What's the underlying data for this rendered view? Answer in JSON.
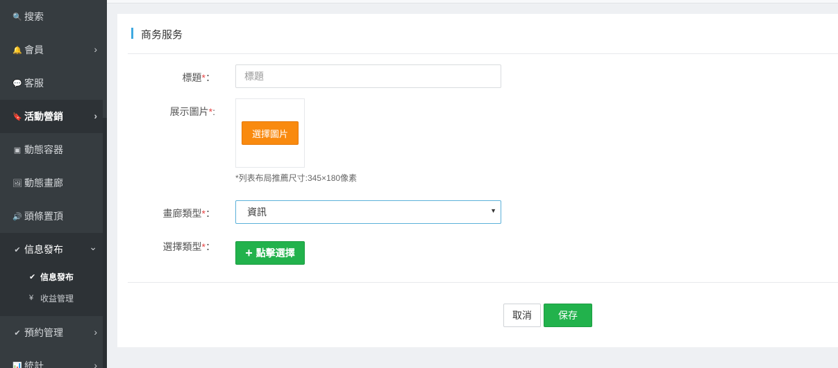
{
  "sidebar": {
    "items": [
      {
        "label": "搜索",
        "icon": "search-icon",
        "glyph": "🔍"
      },
      {
        "label": "會員",
        "icon": "bell-icon",
        "glyph": "🔔"
      },
      {
        "label": "客服",
        "icon": "comment-icon",
        "glyph": "💬"
      },
      {
        "label": "活動營銷",
        "icon": "bookmark-icon",
        "glyph": "🔖"
      },
      {
        "label": "動態容器",
        "icon": "inbox-icon",
        "glyph": "▣"
      },
      {
        "label": "動態畫廊",
        "icon": "picture-icon",
        "glyph": "🖼"
      },
      {
        "label": "頭條置頂",
        "icon": "megaphone-icon",
        "glyph": "🔊"
      },
      {
        "label": "信息發布",
        "icon": "check-icon",
        "glyph": "✔"
      },
      {
        "label": "預約管理",
        "icon": "check-icon",
        "glyph": "✔"
      },
      {
        "label": "統計",
        "icon": "bar-chart-icon",
        "glyph": "📊"
      }
    ],
    "sub_items": [
      {
        "label": "信息發布",
        "icon": "check-icon",
        "glyph": "✔"
      },
      {
        "label": "收益管理",
        "icon": "yen-icon",
        "glyph": "¥"
      }
    ],
    "chevron_right": "›",
    "chevron_down": "⌄"
  },
  "card": {
    "title": "商务服务"
  },
  "form": {
    "title_label": "標題",
    "title_placeholder": "標題",
    "image_label": "展示圖片",
    "image_button": "選擇圖片",
    "image_hint": "*列表布局推薦尺寸:345×180像素",
    "gallery_type_label": "畫廊類型",
    "gallery_type_value": "資訊",
    "select_type_label": "選擇類型",
    "select_type_button": "點擊選擇",
    "required_mark": "*",
    "colon": "："
  },
  "actions": {
    "cancel": "取消",
    "save": "保存"
  },
  "colors": {
    "sidebar_bg": "#363c40",
    "accent_blue": "#3fa9e0",
    "orange": "#f98a0f",
    "green": "#22b24c",
    "required": "#e64545"
  }
}
